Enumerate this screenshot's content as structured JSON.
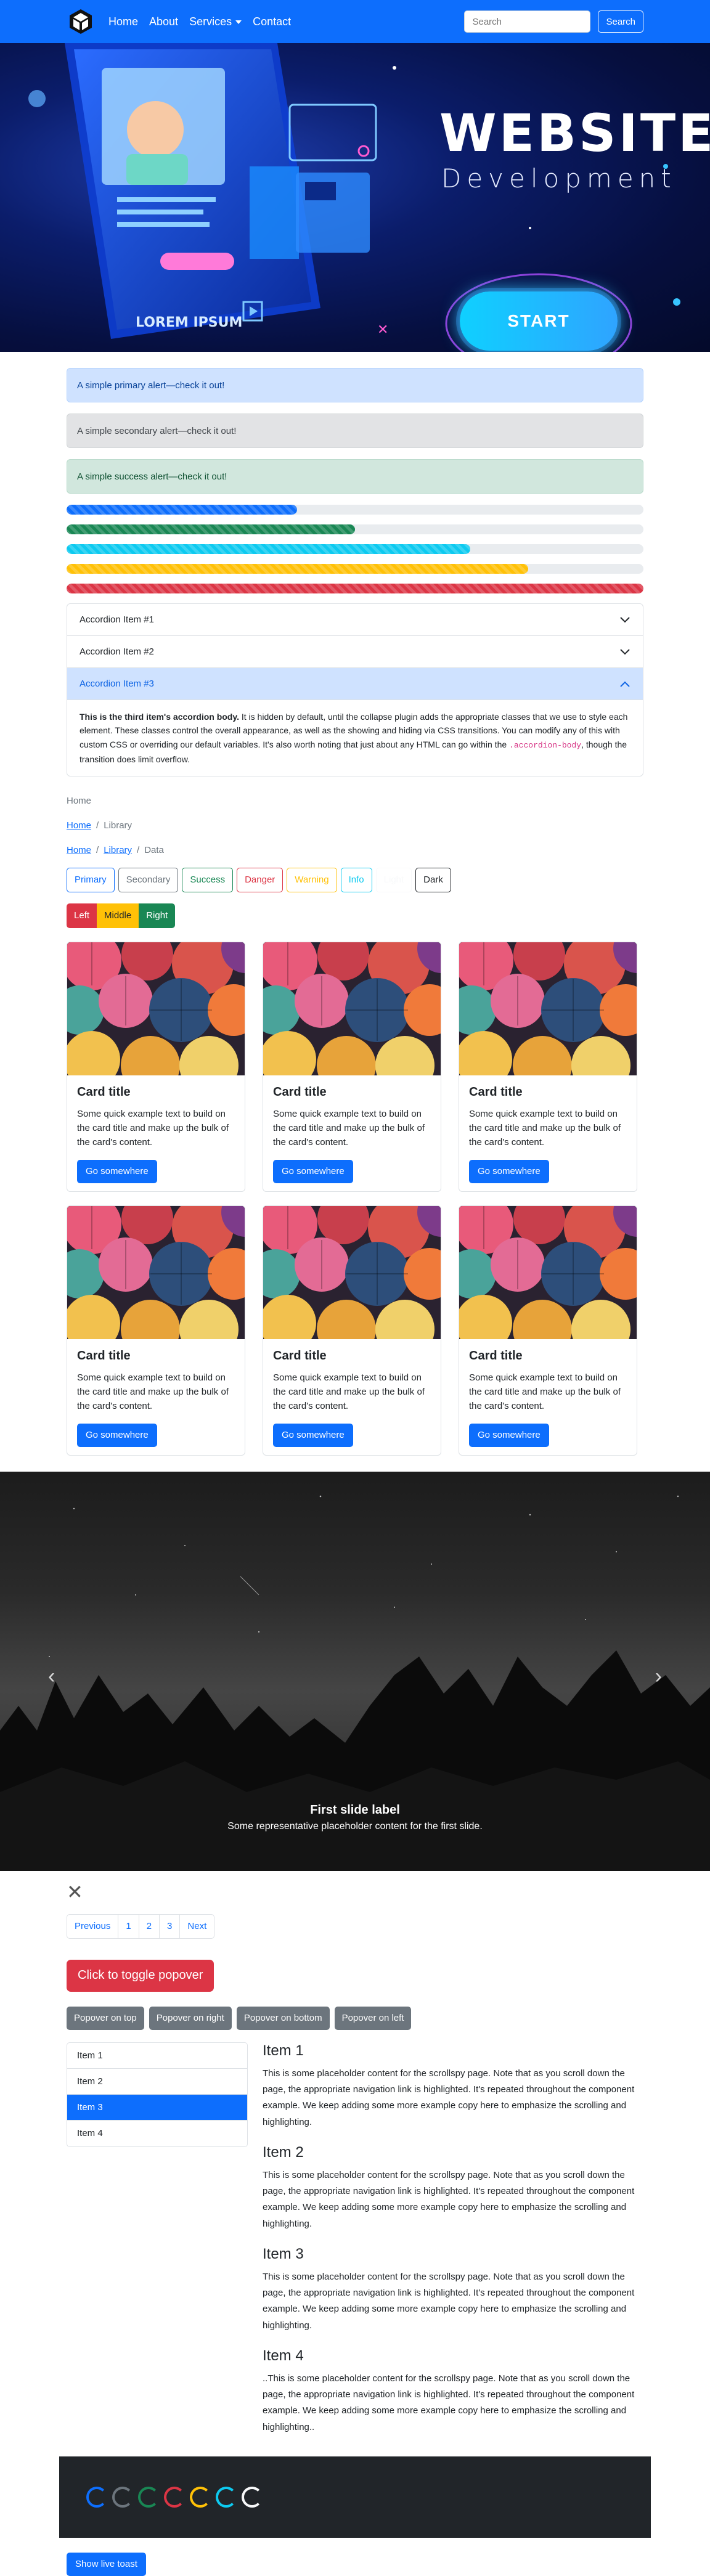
{
  "navbar": {
    "brand_icon": "cube-logo-icon",
    "links": [
      "Home",
      "About",
      "Services",
      "Contact"
    ],
    "search_placeholder": "Search",
    "search_button": "Search"
  },
  "hero": {
    "title": "WEBSITE",
    "subtitle": "Development",
    "start": "START",
    "illustration_text": "LOREM IPSUM"
  },
  "alerts": [
    {
      "type": "primary",
      "text": "A simple primary alert—check it out!"
    },
    {
      "type": "secondary",
      "text": "A simple secondary alert—check it out!"
    },
    {
      "type": "success",
      "text": "A simple success alert—check it out!"
    }
  ],
  "progress": [
    {
      "value": 0.4,
      "color": "#0d6efd"
    },
    {
      "value": 0.5,
      "color": "#198754"
    },
    {
      "value": 0.7,
      "color": "#0dcaf0"
    },
    {
      "value": 0.8,
      "color": "#ffc107"
    },
    {
      "value": 1.0,
      "color": "#dc3545"
    }
  ],
  "accordion": {
    "items": [
      "Accordion Item #1",
      "Accordion Item #2",
      "Accordion Item #3"
    ],
    "body_strong": "This is the third item's accordion body.",
    "body_text": " It is hidden by default, until the collapse plugin adds the appropriate classes that we use to style each element. These classes control the overall appearance, as well as the showing and hiding via CSS transitions. You can modify any of this with custom CSS or overriding our default variables. It's also worth noting that just about any HTML can go within the ",
    "body_code": ".accordion-body",
    "body_end": ", though the transition does limit overflow."
  },
  "breadcrumbs": {
    "home": "Home",
    "library": "Library",
    "data": "Data",
    "sep": "/"
  },
  "outline_buttons": [
    {
      "label": "Primary",
      "color": "#0d6efd"
    },
    {
      "label": "Secondary",
      "color": "#6c757d"
    },
    {
      "label": "Success",
      "color": "#198754"
    },
    {
      "label": "Danger",
      "color": "#dc3545"
    },
    {
      "label": "Warning",
      "color": "#ffc107"
    },
    {
      "label": "Info",
      "color": "#0dcaf0"
    },
    {
      "label": "Light",
      "color": "#f8f9fa"
    },
    {
      "label": "Dark",
      "color": "#212529"
    }
  ],
  "group_buttons": [
    {
      "label": "Left",
      "color": "#dc3545"
    },
    {
      "label": "Middle",
      "color": "#ffc107"
    },
    {
      "label": "Right",
      "color": "#198754"
    }
  ],
  "card": {
    "title": "Card title",
    "text": "Some quick example text to build on the card title and make up the bulk of the card's content.",
    "button": "Go somewhere"
  },
  "carousel": {
    "title": "First slide label",
    "text": "Some representative placeholder content for the first slide."
  },
  "pagination": [
    "Previous",
    "1",
    "2",
    "3",
    "Next"
  ],
  "popover_toggle": "Click to toggle popover",
  "popover_buttons": [
    "Popover on top",
    "Popover on right",
    "Popover on bottom",
    "Popover on left"
  ],
  "scrollspy": {
    "list": [
      "Item 1",
      "Item 2",
      "Item 3",
      "Item 4"
    ],
    "active_index": 2,
    "sections": [
      {
        "title": "Item 1",
        "text": "This is some placeholder content for the scrollspy page. Note that as you scroll down the page, the appropriate navigation link is highlighted. It's repeated throughout the component example. We keep adding some more example copy here to emphasize the scrolling and highlighting."
      },
      {
        "title": "Item 2",
        "text": "This is some placeholder content for the scrollspy page. Note that as you scroll down the page, the appropriate navigation link is highlighted. It's repeated throughout the component example. We keep adding some more example copy here to emphasize the scrolling and highlighting."
      },
      {
        "title": "Item 3",
        "text": "This is some placeholder content for the scrollspy page. Note that as you scroll down the page, the appropriate navigation link is highlighted. It's repeated throughout the component example. We keep adding some more example copy here to emphasize the scrolling and highlighting."
      },
      {
        "title": "Item 4",
        "text": "..This is some placeholder content for the scrollspy page. Note that as you scroll down the page, the appropriate navigation link is highlighted. It's repeated throughout the component example. We keep adding some more example copy here to emphasize the scrolling and highlighting.."
      }
    ]
  },
  "spinner_colors": [
    "#0d6efd",
    "#6c757d",
    "#198754",
    "#dc3545",
    "#ffc107",
    "#0dcaf0",
    "#f8f9fa"
  ],
  "toast_button": "Show live toast"
}
